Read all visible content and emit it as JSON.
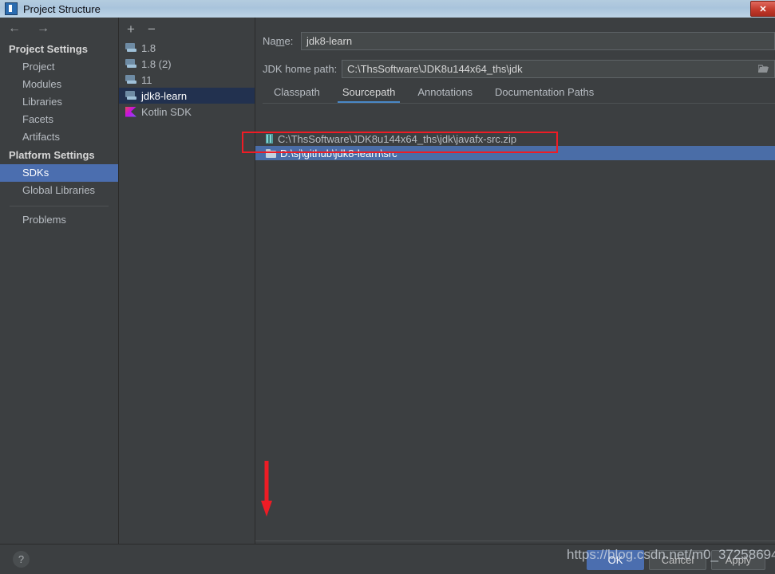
{
  "window": {
    "title": "Project Structure",
    "icon": "app-icon",
    "close_label": "✕"
  },
  "nav": {
    "back": "←",
    "forward": "→"
  },
  "sidebar": {
    "groups": [
      {
        "label": "Project Settings"
      },
      {
        "label": "Platform Settings"
      }
    ],
    "project_items": [
      {
        "label": "Project",
        "selected": false
      },
      {
        "label": "Modules",
        "selected": false
      },
      {
        "label": "Libraries",
        "selected": false
      },
      {
        "label": "Facets",
        "selected": false
      },
      {
        "label": "Artifacts",
        "selected": false
      }
    ],
    "platform_items": [
      {
        "label": "SDKs",
        "selected": true
      },
      {
        "label": "Global Libraries",
        "selected": false
      }
    ],
    "extra_items": [
      {
        "label": "Problems",
        "selected": false
      }
    ]
  },
  "sdk_panel": {
    "add_label": "+",
    "remove_label": "−",
    "items": [
      {
        "label": "1.8",
        "icon": "jdk-icon",
        "selected": false
      },
      {
        "label": "1.8 (2)",
        "icon": "jdk-icon",
        "selected": false
      },
      {
        "label": "11",
        "icon": "jdk-icon",
        "selected": false
      },
      {
        "label": "jdk8-learn",
        "icon": "jdk-icon",
        "selected": true
      },
      {
        "label": "Kotlin SDK",
        "icon": "kotlin-icon",
        "selected": false
      }
    ]
  },
  "details": {
    "name_label_pre": "Na",
    "name_label_mnemonic": "m",
    "name_label_post": "e:",
    "name_value": "jdk8-learn",
    "home_label": "JDK home path:",
    "home_value": "C:\\ThsSoftware\\JDK8u144x64_ths\\jdk",
    "browse_icon": "folder-icon",
    "tabs": [
      {
        "label": "Classpath",
        "active": false
      },
      {
        "label": "Sourcepath",
        "active": true
      },
      {
        "label": "Annotations",
        "active": false
      },
      {
        "label": "Documentation Paths",
        "active": false
      }
    ],
    "paths": [
      {
        "label": "C:\\ThsSoftware\\JDK8u144x64_ths\\jdk\\javafx-src.zip",
        "icon": "zip-icon",
        "selected": false
      },
      {
        "label": "D:\\sj\\github\\jdk8-learn\\src",
        "icon": "folder-icon",
        "selected": true
      }
    ],
    "list_add_label": "+",
    "list_remove_label": "−"
  },
  "footer": {
    "help_label": "?",
    "ok_label": "OK",
    "cancel_label": "Cancel",
    "apply_label": "Apply"
  },
  "watermark": {
    "text": "https://blog.csdn.net/m0_37258694"
  },
  "colors": {
    "accent_blue": "#4b6eaf",
    "selection_blue": "#4a6da7",
    "tab_underline": "#4a88c7",
    "annotation_red": "#ee1c25",
    "panel_bg": "#3c3f41"
  }
}
